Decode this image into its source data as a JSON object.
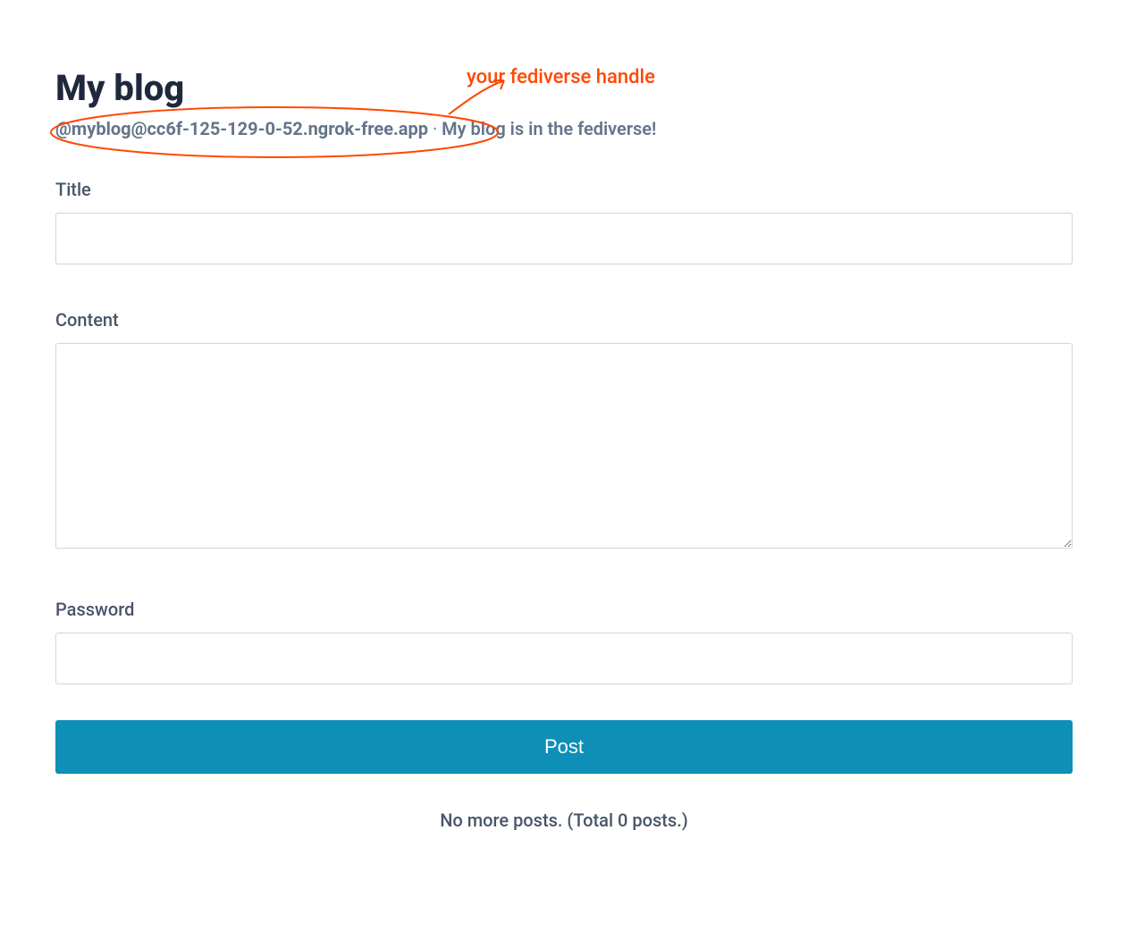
{
  "header": {
    "title": "My blog",
    "handle": "@myblog@cc6f-125-129-0-52.ngrok-free.app",
    "separator": " · ",
    "tagline": "My blog is in the fediverse!"
  },
  "annotation": {
    "text": "your fediverse handle",
    "color": "#ff4800"
  },
  "form": {
    "title": {
      "label": "Title",
      "value": ""
    },
    "content": {
      "label": "Content",
      "value": ""
    },
    "password": {
      "label": "Password",
      "value": ""
    },
    "submit_label": "Post"
  },
  "footer": {
    "status": "No more posts. (Total 0 posts.)"
  },
  "colors": {
    "accent": "#0e8fb8",
    "annotation": "#ff4800"
  }
}
